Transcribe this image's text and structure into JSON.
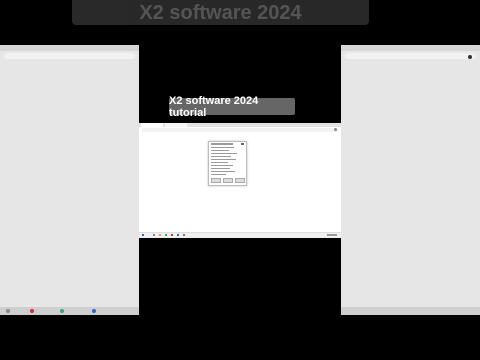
{
  "overlay": {
    "top_title": "X2 software 2024",
    "caption": "X2 software 2024 tutorial"
  },
  "colors": {
    "background": "#000000",
    "caption_bg": "#666666",
    "screen_bg": "#ffffff"
  }
}
